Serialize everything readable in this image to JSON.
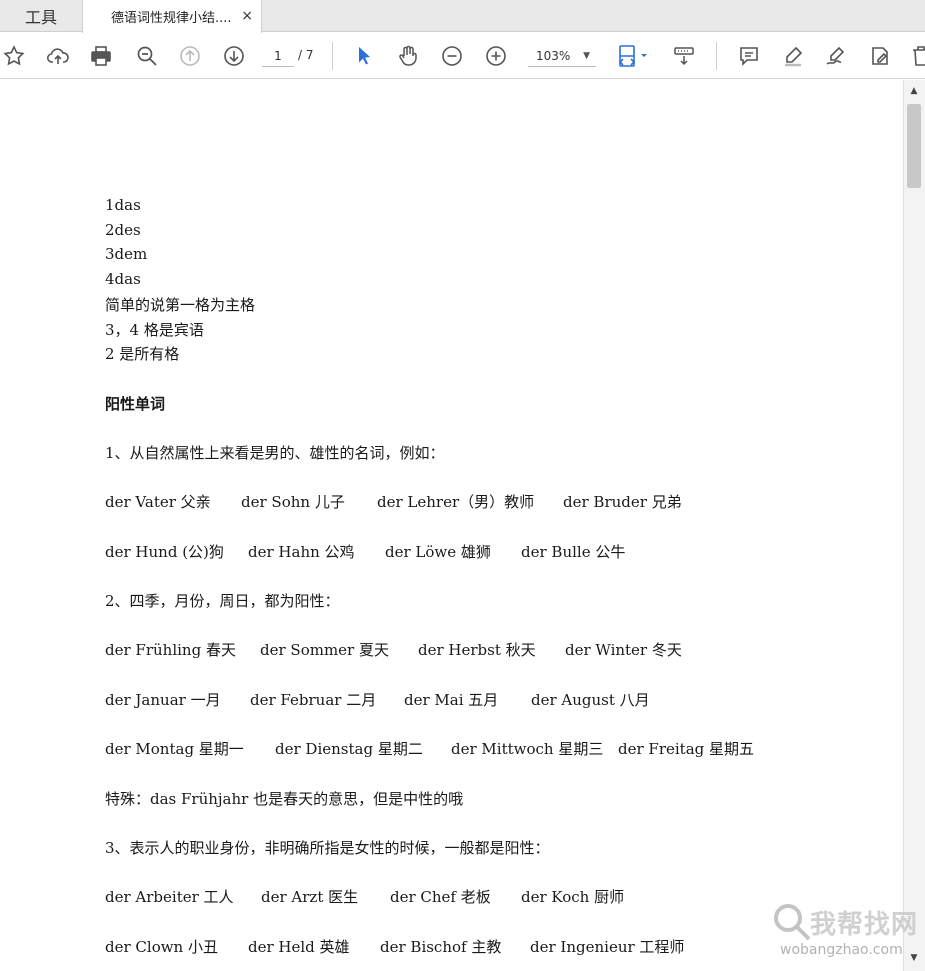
{
  "tabs": {
    "tools_label": "工具",
    "document_title": "德语词性规律小结....",
    "close_glyph": "×"
  },
  "toolbar": {
    "page_current": "1",
    "page_total": "/ 7",
    "zoom": "103%",
    "icons": [
      "star-icon",
      "cloud-upload-icon",
      "print-icon",
      "search-zoom-icon",
      "page-up-icon",
      "page-down-icon",
      "select-pointer-icon",
      "hand-tool-icon",
      "zoom-out-icon",
      "zoom-in-icon",
      "fit-page-icon",
      "read-mode-icon",
      "comment-icon",
      "highlight-icon",
      "sign-icon",
      "share-edit-icon",
      "delete-icon"
    ]
  },
  "document": {
    "lines": [
      {
        "text": "1das"
      },
      {
        "text": "2des"
      },
      {
        "text": "3dem"
      },
      {
        "text": "4das"
      },
      {
        "text": "简单的说第一格为主格"
      },
      {
        "text": "3，4 格是宾语"
      },
      {
        "text": "2 是所有格"
      },
      {
        "text": "阳性单词",
        "bold": true
      },
      {
        "text": "1、从自然属性上来看是男的、雄性的名词，例如："
      },
      {
        "items": [
          "der Vater  父亲",
          "der Sohn  儿子",
          "der Lehrer（男）教师",
          "der Bruder  兄弟"
        ]
      },
      {
        "items": [
          "der Hund (公)狗",
          "der Hahn  公鸡",
          "der Löwe  雄狮",
          "der Bulle  公牛"
        ]
      },
      {
        "text": "2、四季，月份，周日，都为阳性："
      },
      {
        "items": [
          "der Frühling  春天",
          "der Sommer  夏天",
          "der Herbst  秋天",
          "der Winter  冬天"
        ]
      },
      {
        "items": [
          "der Januar  一月",
          "der Februar  二月",
          "der Mai  五月",
          "der August  八月"
        ]
      },
      {
        "items": [
          "der Montag  星期一",
          "der Dienstag  星期二",
          "der Mittwoch  星期三",
          "der Freitag  星期五"
        ]
      },
      {
        "text": "特殊：das Frühjahr 也是春天的意思，但是中性的哦"
      },
      {
        "text": "3、表示人的职业身份，非明确所指是女性的时候，一般都是阳性："
      },
      {
        "items": [
          "der Arbeiter  工人",
          "der Arzt  医生",
          "der Chef  老板",
          "der Koch  厨师"
        ]
      },
      {
        "items": [
          "der Clown  小丑",
          "der Held  英雄",
          "der Bischof  主教",
          "der Ingenieur  工程师"
        ]
      }
    ]
  },
  "watermark": {
    "cn": "我帮找网",
    "en": "wobangzhao.com"
  },
  "colors": {
    "accent": "#2a6fdb",
    "icon": "#555555"
  }
}
